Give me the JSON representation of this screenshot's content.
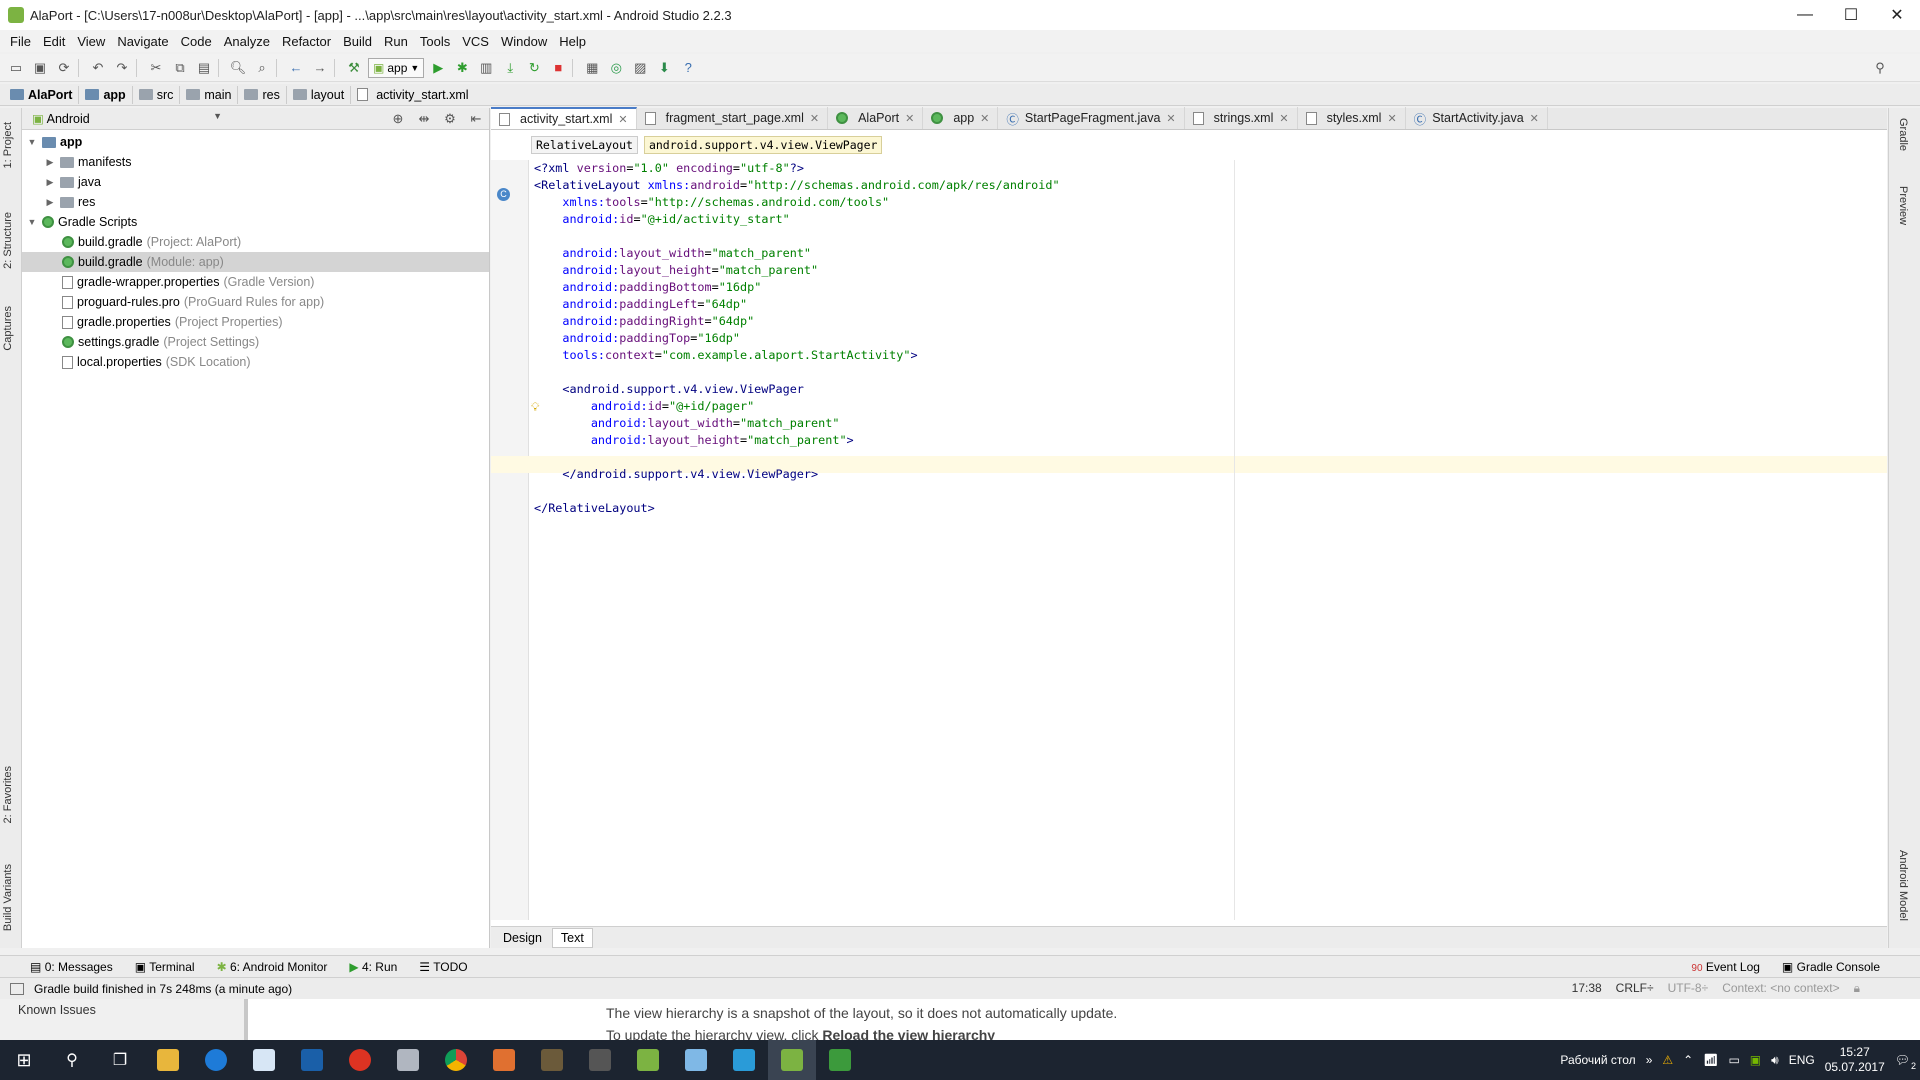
{
  "window": {
    "title": "AlaPort - [C:\\Users\\17-n008ur\\Desktop\\AlaPort] - [app] - ...\\app\\src\\main\\res\\layout\\activity_start.xml - Android Studio 2.2.3",
    "minimize": "—",
    "maximize": "☐",
    "close": "✕"
  },
  "menu": [
    "File",
    "Edit",
    "View",
    "Navigate",
    "Code",
    "Analyze",
    "Refactor",
    "Build",
    "Run",
    "Tools",
    "VCS",
    "Window",
    "Help"
  ],
  "toolbar": {
    "run_config": "app"
  },
  "breadcrumb": [
    "AlaPort",
    "app",
    "src",
    "main",
    "res",
    "layout",
    "activity_start.xml"
  ],
  "left_strip": {
    "project": "1: Project",
    "structure": "2: Structure",
    "captures": "Captures",
    "favorites": "2: Favorites",
    "build_variants": "Build Variants"
  },
  "project": {
    "view_mode": "Android",
    "tree": [
      {
        "label": "app",
        "hint": ""
      },
      {
        "label": "manifests",
        "hint": ""
      },
      {
        "label": "java",
        "hint": ""
      },
      {
        "label": "res",
        "hint": ""
      },
      {
        "label": "Gradle Scripts",
        "hint": ""
      },
      {
        "label": "build.gradle",
        "hint": "(Project: AlaPort)"
      },
      {
        "label": "build.gradle",
        "hint": "(Module: app)"
      },
      {
        "label": "gradle-wrapper.properties",
        "hint": "(Gradle Version)"
      },
      {
        "label": "proguard-rules.pro",
        "hint": "(ProGuard Rules for app)"
      },
      {
        "label": "gradle.properties",
        "hint": "(Project Properties)"
      },
      {
        "label": "settings.gradle",
        "hint": "(Project Settings)"
      },
      {
        "label": "local.properties",
        "hint": "(SDK Location)"
      }
    ]
  },
  "editor": {
    "tabs": [
      "activity_start.xml",
      "fragment_start_page.xml",
      "AlaPort",
      "app",
      "StartPageFragment.java",
      "strings.xml",
      "styles.xml",
      "StartActivity.java"
    ],
    "structure_crumbs": [
      "RelativeLayout",
      "android.support.v4.view.ViewPager"
    ],
    "design_tabs": [
      "Design",
      "Text"
    ]
  },
  "right_strip": {
    "gradle": "Gradle",
    "preview": "Preview",
    "android_model": "Android Model"
  },
  "bottom_tools": {
    "messages": "0: Messages",
    "terminal": "Terminal",
    "monitor": "6: Android Monitor",
    "run": "4: Run",
    "todo": "TODO",
    "event_log": "Event Log",
    "event_count": "90",
    "gradle_console": "Gradle Console"
  },
  "status": {
    "message": "Gradle build finished in 7s 248ms (a minute ago)",
    "position": "17:38",
    "line_sep": "CRLF÷",
    "encoding": "UTF-8÷",
    "context": "Context: <no context>"
  },
  "behind_window": {
    "known_issues": "Known Issues",
    "line1": "The view hierarchy is a snapshot of the layout, so it does not automatically update.",
    "line2_prefix": "To update the hierarchy view, click ",
    "line2_link": "Reload the view hierarchy"
  },
  "taskbar": {
    "desktop_label": "Рабочий стол",
    "lang": "ENG",
    "time": "15:27",
    "date": "05.07.2017",
    "notif": "2"
  },
  "colors": {
    "accent": "#4a7cc7",
    "caret_line": "#fffae3",
    "taskbar": "#1c2430"
  }
}
